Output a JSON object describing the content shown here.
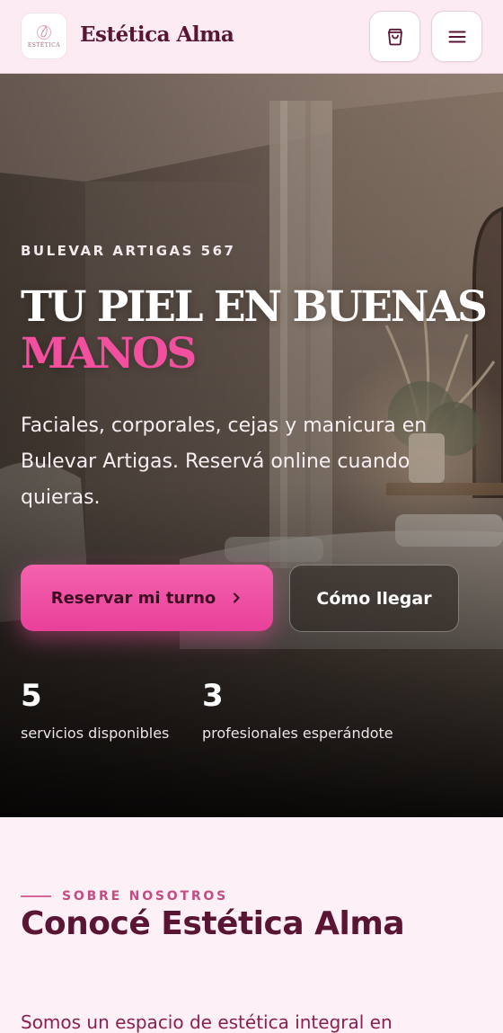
{
  "header": {
    "logo_text": "ESTÉTICA",
    "brand_name": "Estética Alma",
    "icons": {
      "cart": "cart-icon",
      "menu": "menu-icon"
    }
  },
  "hero": {
    "eyebrow": "BULEVAR ARTIGAS 567",
    "title_line1": "TU PIEL EN BUENAS",
    "title_accent": "MANOS",
    "description": "Faciales, corporales, cejas y manicura en Bulevar Artigas. Reservá online cuando quieras.",
    "primary_button": "Reservar mi turno",
    "secondary_button": "Cómo llegar",
    "stats": [
      {
        "value": "5",
        "label": "servicios disponibles"
      },
      {
        "value": "3",
        "label": "profesionales esperándote"
      }
    ]
  },
  "about": {
    "eyebrow": "SOBRE NOSOTROS",
    "title": "Conocé Estética Alma",
    "text": "Somos un espacio de estética integral en"
  },
  "colors": {
    "brand": "#5a1535",
    "accent": "#f24f9f",
    "header_bg": "#fcebf3",
    "page_bg": "#fdf0f6"
  }
}
